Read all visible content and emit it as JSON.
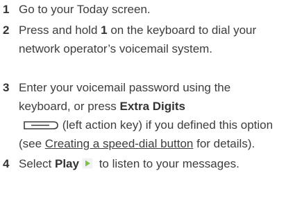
{
  "steps": [
    {
      "number": "1",
      "text": "Go to your Today screen."
    },
    {
      "number": "2",
      "text_before": "Press and hold ",
      "bold": "1",
      "text_after": " on the keyboard to dial your network operator’s voicemail system."
    },
    {
      "number": "3",
      "text_before": "Enter your voicemail password using the keyboard, or press ",
      "bold": "Extra Digits",
      "text_middle": " (left action key) if you defined this option (see ",
      "link": "Creating a speed-dial button",
      "text_after": " for details)."
    },
    {
      "number": "4",
      "text_before": "Select ",
      "bold": "Play",
      "text_after": " to listen to your messages."
    }
  ],
  "icons": {
    "left_action_key": "left-action-key-icon",
    "play": "play-icon"
  },
  "colors": {
    "text": "#3d3d3d",
    "play_icon_fill": "#7cc242"
  }
}
